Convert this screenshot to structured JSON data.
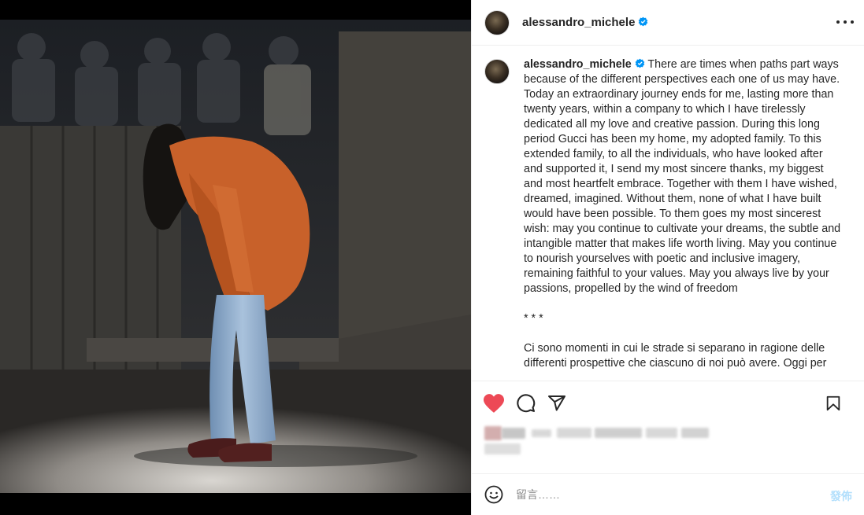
{
  "post": {
    "username": "alessandro_michele",
    "verified_icon": "verified-badge-icon",
    "caption_paragraphs": [
      "There are times when paths part ways because of the different perspectives each one of us may have. Today an extraordinary journey ends for me, lasting more than twenty years, within a company to which I have tirelessly dedicated all my love and creative passion. During this long period Gucci has been my home, my adopted family. To this extended family, to all the individuals, who have looked after and supported it, I send my most sincere thanks, my biggest and most heartfelt embrace. Together with them I have wished, dreamed, imagined. Without them, none of what I have built would have been possible. To them goes my most sincerest wish: may you continue to cultivate your dreams, the subtle and intangible matter that makes life worth living. May you continue to nourish yourselves with poetic and inclusive imagery, remaining faithful to your values. May you always live by your passions, propelled by the wind of freedom",
      "* * *",
      "Ci sono momenti in cui le strade si separano in ragione delle differenti prospettive che ciascuno di noi può avere. Oggi per"
    ]
  },
  "actions": {
    "like_icon": "heart-filled-icon",
    "comment_icon": "comment-icon",
    "share_icon": "share-icon",
    "save_icon": "bookmark-icon",
    "like_color": "#ed4956"
  },
  "comment": {
    "placeholder": "留言……",
    "post_label": "發佈",
    "emoji_icon": "emoji-icon"
  }
}
